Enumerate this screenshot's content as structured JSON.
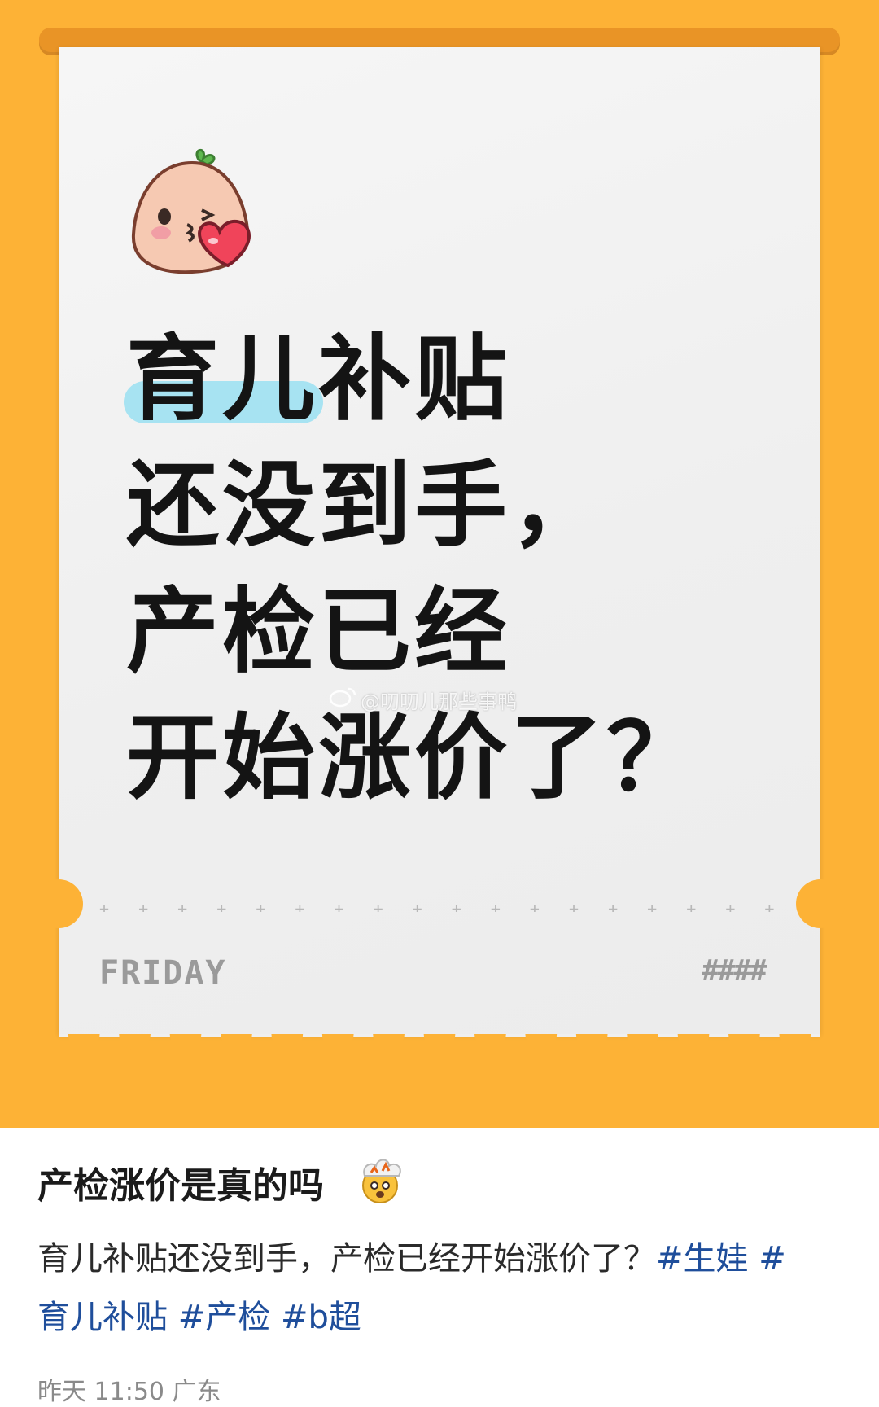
{
  "poster": {
    "headline_lines": [
      "育儿补贴",
      "还没到手，",
      "产检已经",
      "开始涨价了？"
    ],
    "watermark": "@叨叨儿那些事鸭",
    "day_label": "FRIDAY",
    "hash_mark": "####",
    "divider": "+ + + + + + + + + + + + + + + + + + + + + + + + + + + + +",
    "mascot_icon": "kissing-peach-heart-icon",
    "colors": {
      "frame": "#FDB236",
      "rod": "#E99426",
      "highlight": "#A7E3F2"
    }
  },
  "post": {
    "title": "产检涨价是真的吗",
    "title_emoji_icon": "exploding-head-icon",
    "body_text": "育儿补贴还没到手，产检已经开始涨价了？",
    "tags": [
      "#生娃 #",
      "育儿补贴",
      " #产检",
      " #b超"
    ],
    "meta": "昨天 11:50 广东",
    "tag_color": "#1F4E9B"
  }
}
